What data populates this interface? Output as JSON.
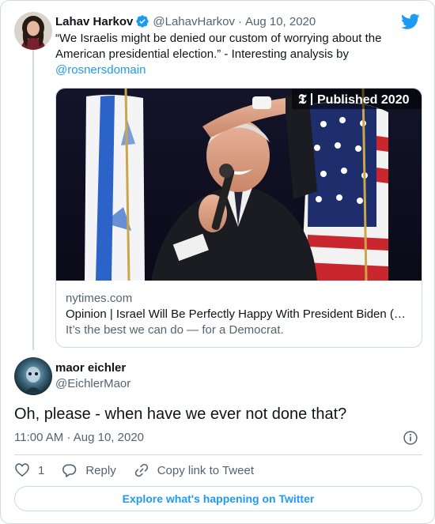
{
  "quoted_tweet": {
    "author_name": "Lahav Harkov",
    "author_handle": "@LahavHarkov",
    "date": "Aug 10, 2020",
    "verified": true,
    "text_before_mention": "“We Israelis might be denied our custom of worrying about the American presidential election.” - Interesting analysis by",
    "mention": "@rosnersdomain",
    "link_card": {
      "image_badge": "Published 2020",
      "image_badge_logo": "nyt-logo-icon",
      "domain": "nytimes.com",
      "title": "Opinion | Israel Will Be Perfectly Happy With President Biden (…",
      "description": "It’s the best we can do — for a Democrat."
    }
  },
  "reply_tweet": {
    "author_name": "maor eichler",
    "author_handle": "@EichlerMaor",
    "text": "Oh, please - when have we ever not done that?",
    "timestamp": "11:00 AM · Aug 10, 2020"
  },
  "actions": {
    "like_count": "1",
    "reply_label": "Reply",
    "copy_link_label": "Copy link to Tweet"
  },
  "explore_label": "Explore what's happening on Twitter",
  "colors": {
    "accent": "#1d9bf0",
    "text": "#0f1419",
    "muted": "#536471",
    "border": "#cfd9de"
  },
  "icons": [
    "twitter-bird-icon",
    "verified-badge-icon",
    "info-icon",
    "heart-icon",
    "reply-icon",
    "link-icon"
  ]
}
